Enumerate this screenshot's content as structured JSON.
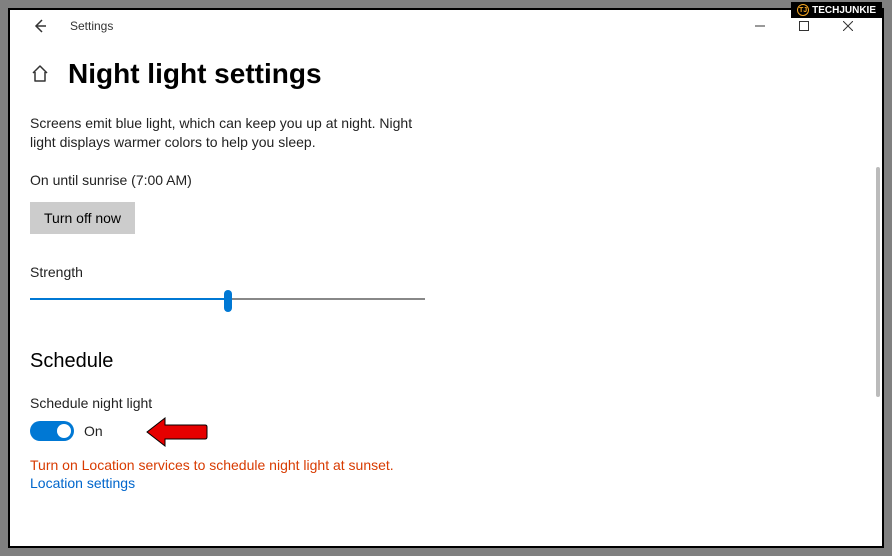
{
  "watermark": {
    "brand": "TECHJUNKIE",
    "icon_text": "TJ"
  },
  "titlebar": {
    "title": "Settings"
  },
  "page": {
    "heading": "Night light settings",
    "description": "Screens emit blue light, which can keep you up at night. Night light displays warmer colors to help you sleep.",
    "status": "On until sunrise (7:00 AM)",
    "turnoff_label": "Turn off now",
    "strength_label": "Strength",
    "strength_pct": 50
  },
  "schedule": {
    "heading": "Schedule",
    "label": "Schedule night light",
    "toggle_state": "On",
    "warning": "Turn on Location services to schedule night light at sunset.",
    "link": "Location settings"
  }
}
